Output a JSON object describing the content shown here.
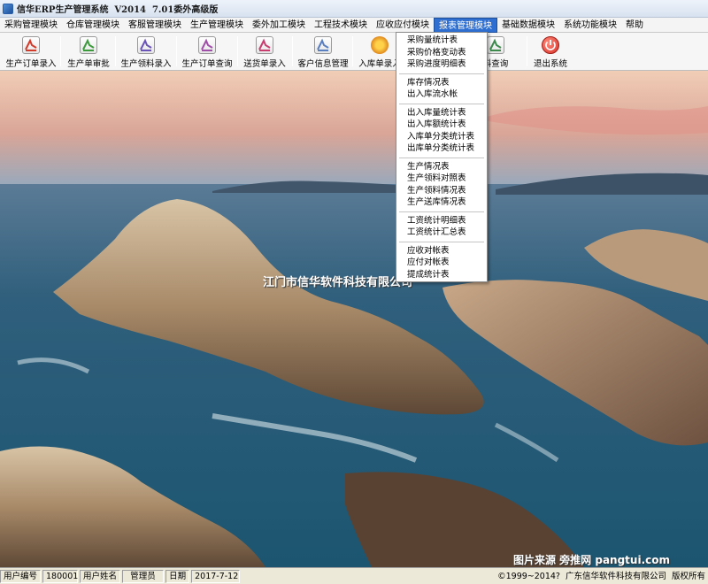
{
  "window": {
    "title": "信华ERP生产管理系统  V2014  7.01委外高级版"
  },
  "menubar": {
    "items": [
      "采购管理模块",
      "仓库管理模块",
      "客服管理模块",
      "生产管理模块",
      "委外加工模块",
      "工程技术模块",
      "应收应付模块",
      "报表管理模块",
      "基础数据模块",
      "系统功能模块",
      "帮助"
    ],
    "active_index": 7
  },
  "toolbar": {
    "buttons": [
      {
        "label": "生产订单录入",
        "icon": "pdf-document-icon",
        "color": "#d23a2a"
      },
      {
        "label": "生产单审批",
        "icon": "approve-document-icon",
        "color": "#3c9a3c"
      },
      {
        "label": "生产领料录入",
        "icon": "requisition-document-icon",
        "color": "#6b54b8"
      },
      {
        "label": "生产订单查询",
        "icon": "search-document-icon",
        "color": "#a04fa8"
      },
      {
        "label": "送货单录入",
        "icon": "delivery-document-icon",
        "color": "#c83c6e"
      },
      {
        "label": "客户信息管理",
        "icon": "customer-document-icon",
        "color": "#5a7fc0"
      },
      {
        "label": "入库单录入",
        "icon": "warehouse-flower-icon",
        "color": "#e08a1e"
      },
      {
        "label": "料查询",
        "icon": "material-query-icon",
        "color": "#3c8a4c"
      },
      {
        "label": "退出系统",
        "icon": "power-exit-icon",
        "color": "#d9322a"
      }
    ]
  },
  "report_menu": {
    "groups": [
      [
        "采购量统计表",
        "采购价格变动表",
        "采购进度明细表"
      ],
      [
        "库存情况表",
        "出入库流水帐"
      ],
      [
        "出入库量统计表",
        "出入库额统计表",
        "入库单分类统计表",
        "出库单分类统计表"
      ],
      [
        "生产情况表",
        "生产领料对照表",
        "生产领料情况表",
        "生产送库情况表"
      ],
      [
        "工资统计明细表",
        "工资统计汇总表"
      ],
      [
        "应收对帐表",
        "应付对帐表",
        "提成统计表"
      ]
    ]
  },
  "desktop": {
    "watermark_company": "江门市信华软件科技有限公司",
    "watermark_source": "图片来源 旁推网 pangtui.com"
  },
  "statusbar": {
    "user_id_label": "用户编号",
    "user_id": "180001",
    "user_name_label": "用户姓名",
    "user_name": "管理员",
    "date_label": "日期",
    "date": "2017-7-12",
    "copyright": "©1999~2014?",
    "company": "广东信华软件科技有限公司",
    "rights": "版权所有"
  }
}
